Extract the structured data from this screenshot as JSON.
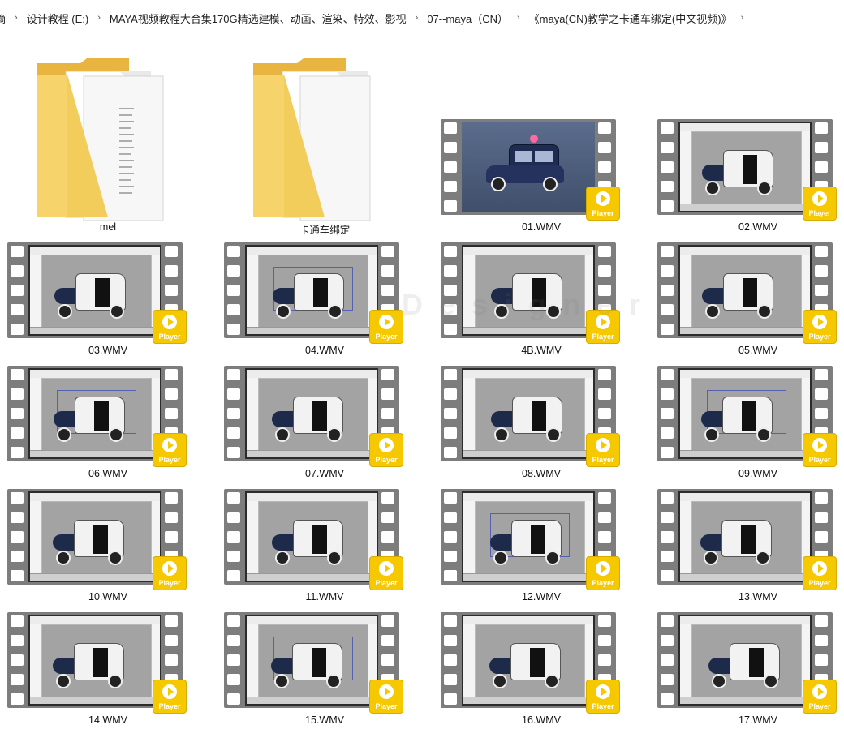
{
  "breadcrumb": [
    "摘",
    "设计教程 (E:)",
    "MAYA视频教程大合集170G精选建模、动画、渲染、特效、影视",
    "07--maya（CN）",
    "《maya(CN)教学之卡通车绑定(中文视频)》"
  ],
  "folders": [
    {
      "name": "mel"
    },
    {
      "name": "卡通车绑定"
    }
  ],
  "videos": [
    {
      "name": "01.WMV",
      "badge": "Player"
    },
    {
      "name": "02.WMV",
      "badge": "Player"
    },
    {
      "name": "03.WMV",
      "badge": "Player"
    },
    {
      "name": "04.WMV",
      "badge": "Player"
    },
    {
      "name": "4B.WMV",
      "badge": "Player"
    },
    {
      "name": "05.WMV",
      "badge": "Player"
    },
    {
      "name": "06.WMV",
      "badge": "Player"
    },
    {
      "name": "07.WMV",
      "badge": "Player"
    },
    {
      "name": "08.WMV",
      "badge": "Player"
    },
    {
      "name": "09.WMV",
      "badge": "Player"
    },
    {
      "name": "10.WMV",
      "badge": "Player"
    },
    {
      "name": "11.WMV",
      "badge": "Player"
    },
    {
      "name": "12.WMV",
      "badge": "Player"
    },
    {
      "name": "13.WMV",
      "badge": "Player"
    },
    {
      "name": "14.WMV",
      "badge": "Player"
    },
    {
      "name": "15.WMV",
      "badge": "Player"
    },
    {
      "name": "16.WMV",
      "badge": "Player"
    },
    {
      "name": "17.WMV",
      "badge": "Player"
    }
  ],
  "colors": {
    "badge": "#f5c800",
    "film": "#7d7d7d",
    "folder": "#f7d675"
  }
}
